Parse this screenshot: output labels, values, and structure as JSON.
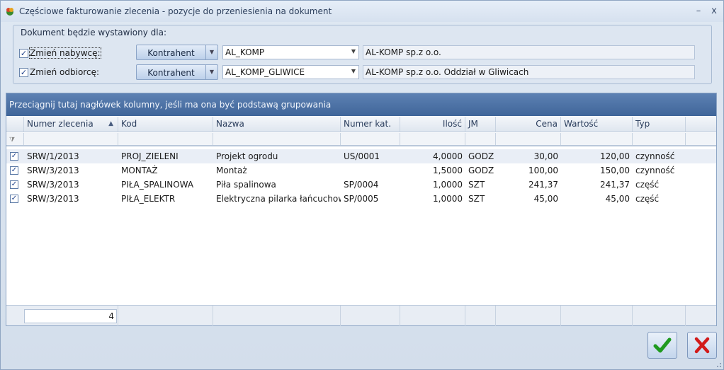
{
  "window": {
    "title": "Częściowe fakturowanie zlecenia - pozycje do przeniesienia na dokument",
    "minimize_glyph": "–",
    "close_glyph": "x"
  },
  "recipient_group": {
    "legend": "Dokument będzie wystawiony dla:",
    "buyer": {
      "checkbox_label": "Zmień nabywcę:",
      "checked": true,
      "button_label": "Kontrahent",
      "code": "AL_KOMP",
      "name": "AL-KOMP sp.z o.o."
    },
    "receiver": {
      "checkbox_label": "Zmień odbiorcę:",
      "checked": true,
      "button_label": "Kontrahent",
      "code": "AL_KOMP_GLIWICE",
      "name": "AL-KOMP sp.z o.o. Oddział w Gliwicach"
    }
  },
  "grid": {
    "group_panel_text": "Przeciągnij tutaj nagłówek kolumny, jeśli ma ona być podstawą grupowania",
    "columns": [
      "Numer zlecenia",
      "Kod",
      "Nazwa",
      "Numer kat.",
      "Ilość",
      "JM",
      "Cena",
      "Wartość",
      "Typ"
    ],
    "sort_indicator": "▲",
    "rows": [
      {
        "checked": true,
        "order": "SRW/1/2013",
        "code": "PROJ_ZIELENI",
        "name": "Projekt ogrodu",
        "catalog": "US/0001",
        "qty": "4,0000",
        "unit": "GODZ",
        "price": "30,00",
        "value": "120,00",
        "type": "czynność"
      },
      {
        "checked": true,
        "order": "SRW/3/2013",
        "code": "MONTAŻ",
        "name": "Montaż",
        "catalog": "",
        "qty": "1,5000",
        "unit": "GODZ",
        "price": "100,00",
        "value": "150,00",
        "type": "czynność"
      },
      {
        "checked": true,
        "order": "SRW/3/2013",
        "code": "PIŁA_SPALINOWA",
        "name": "Piła spalinowa",
        "catalog": "SP/0004",
        "qty": "1,0000",
        "unit": "SZT",
        "price": "241,37",
        "value": "241,37",
        "type": "część"
      },
      {
        "checked": true,
        "order": "SRW/3/2013",
        "code": "PIŁA_ELEKTR",
        "name": "Elektryczna pilarka łańcuchowa",
        "catalog": "SP/0005",
        "qty": "1,0000",
        "unit": "SZT",
        "price": "45,00",
        "value": "45,00",
        "type": "część"
      }
    ],
    "footer_count": "4"
  },
  "actions": {
    "confirm_icon": "checkmark-icon",
    "cancel_icon": "cross-icon",
    "confirm_color": "#1f9a1f",
    "cancel_color": "#d21a1a"
  }
}
